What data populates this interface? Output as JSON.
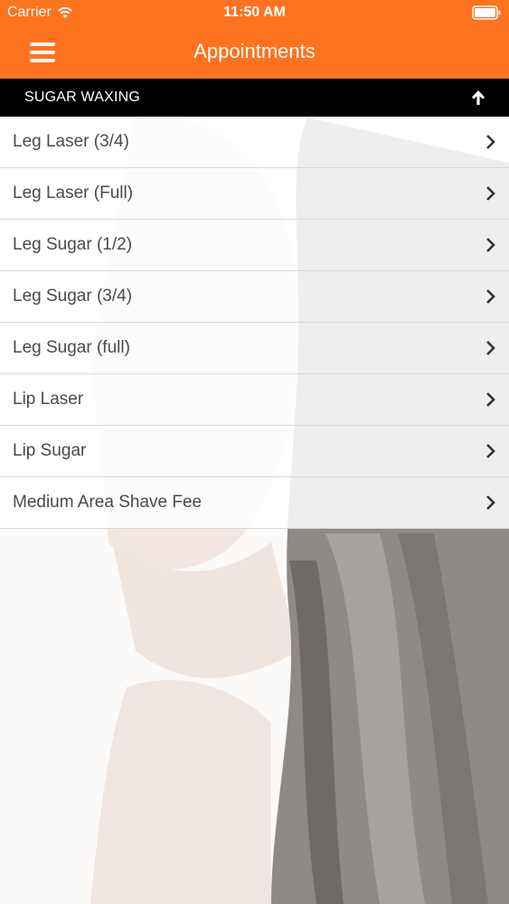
{
  "status_bar": {
    "carrier": "Carrier",
    "time": "11:50 AM",
    "wifi_icon": "wifi-icon",
    "battery_icon": "battery-icon"
  },
  "nav": {
    "title": "Appointments",
    "menu_icon": "hamburger-menu-icon"
  },
  "section": {
    "title": "SUGAR WAXING",
    "collapse_icon": "arrow-up-icon"
  },
  "services": [
    {
      "label": "Leg Laser (3/4)"
    },
    {
      "label": "Leg Laser (Full)"
    },
    {
      "label": "Leg Sugar (1/2)"
    },
    {
      "label": "Leg Sugar (3/4)"
    },
    {
      "label": "Leg Sugar (full)"
    },
    {
      "label": "Lip Laser"
    },
    {
      "label": "Lip Sugar"
    },
    {
      "label": "Medium Area Shave Fee"
    }
  ],
  "colors": {
    "brand_orange": "#fd7320",
    "section_black": "#000000",
    "item_text": "#4a4a4a"
  }
}
